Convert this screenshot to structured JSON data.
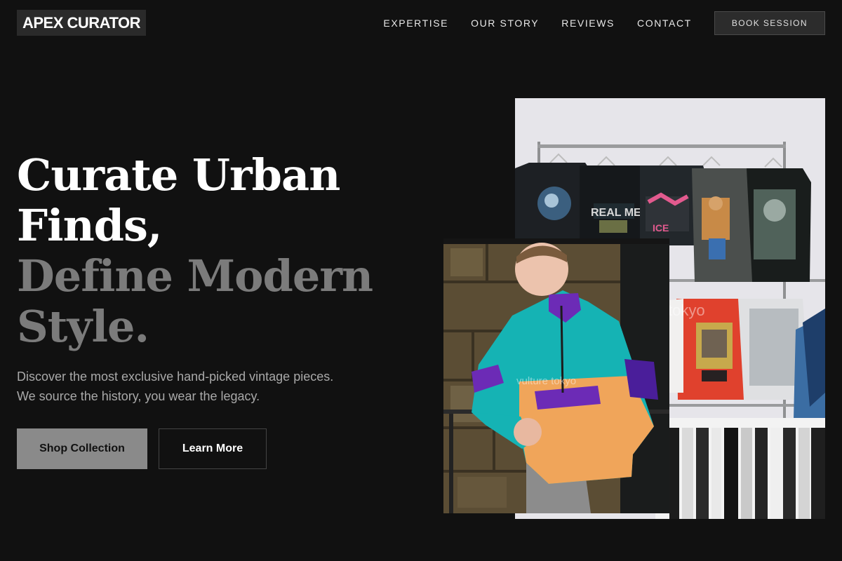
{
  "brand": {
    "logo_text": "APEX CURATOR"
  },
  "nav": {
    "items": [
      {
        "label": "EXPERTISE"
      },
      {
        "label": "OUR STORY"
      },
      {
        "label": "REVIEWS"
      },
      {
        "label": "CONTACT"
      }
    ],
    "cta_label": "BOOK SESSION"
  },
  "hero": {
    "title_line1": "Curate Urban",
    "title_line2": "Finds,",
    "title_line3": "Define Modern",
    "title_line4": "Style.",
    "description": "Discover the most exclusive hand-picked vintage pieces. We source the history, you wear the legacy.",
    "primary_button": "Shop Collection",
    "secondary_button": "Learn More"
  },
  "images": {
    "rack_watermark": "tokyo",
    "person_watermark": "vulture tokyo",
    "tshirt_print_1": "REAL MEN",
    "tshirt_print_2": "ICE"
  },
  "colors": {
    "background": "#111111",
    "title_primary": "#ffffff",
    "title_secondary": "#7b7b7b",
    "body_text": "#a9a9a9",
    "primary_button_bg": "#8a8a8a"
  }
}
